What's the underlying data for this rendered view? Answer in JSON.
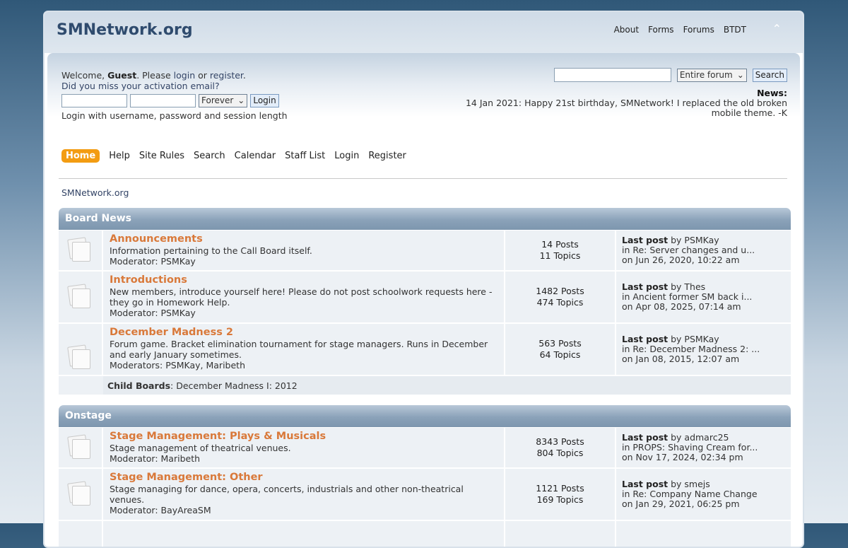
{
  "site": {
    "title": "SMNetwork.org"
  },
  "top_nav": [
    "About",
    "Forms",
    "Forums",
    "BTDT"
  ],
  "user": {
    "welcome_prefix": "Welcome, ",
    "guest": "Guest",
    "please": ". Please ",
    "login": "login",
    "or": " or ",
    "register": "register",
    "period": ".",
    "activation": "Did you miss your activation email?",
    "session": "Forever",
    "login_button": "Login",
    "note": "Login with username, password and session length"
  },
  "search": {
    "scope": "Entire forum",
    "button": "Search"
  },
  "news": {
    "label": "News:",
    "text": "14 Jan 2021: Happy 21st birthday, SMNetwork! I replaced the old broken mobile theme. -K"
  },
  "menu": [
    "Home",
    "Help",
    "Site Rules",
    "Search",
    "Calendar",
    "Staff List",
    "Login",
    "Register"
  ],
  "breadcrumb": "SMNetwork.org",
  "categories": [
    {
      "name": "Board News",
      "boards": [
        {
          "name": "Announcements",
          "desc": "Information pertaining to the Call Board itself.",
          "mods": "Moderator: PSMKay",
          "posts": "14 Posts",
          "topics": "11 Topics",
          "last_label": "Last post",
          "last_by": " by PSMKay",
          "last_in": "in Re: Server changes and u...",
          "last_on": "on Jun 26, 2020, 10:22 am"
        },
        {
          "name": "Introductions",
          "desc": "New members, introduce yourself here! Please do not post schoolwork requests here - they go in Homework Help.",
          "mods": "Moderator: PSMKay",
          "posts": "1482 Posts",
          "topics": "474 Topics",
          "last_label": "Last post",
          "last_by": " by Thes",
          "last_in": "in Ancient former SM back i...",
          "last_on": "on Apr 08, 2025, 07:14 am"
        },
        {
          "name": "December Madness 2",
          "desc": "Forum game. Bracket elimination tournament for stage managers. Runs in December and early January sometimes.",
          "mods": "Moderators: PSMKay, Maribeth",
          "posts": "563 Posts",
          "topics": "64 Topics",
          "last_label": "Last post",
          "last_by": " by PSMKay",
          "last_in": "in Re: December Madness 2: ...",
          "last_on": "on Jan 08, 2015, 12:07 am"
        }
      ],
      "child_label": "Child Boards",
      "child_boards": ": December Madness I: 2012"
    },
    {
      "name": "Onstage",
      "boards": [
        {
          "name": "Stage Management: Plays & Musicals",
          "desc": "Stage management of theatrical venues.",
          "mods": "Moderator: Maribeth",
          "posts": "8343 Posts",
          "topics": "804 Topics",
          "last_label": "Last post",
          "last_by": " by admarc25",
          "last_in": "in PROPS: Shaving Cream for...",
          "last_on": "on Nov 17, 2024, 02:34 pm"
        },
        {
          "name": "Stage Management: Other",
          "desc": "Stage managing for dance, opera, concerts, industrials and other non-theatrical venues.",
          "mods": "Moderator: BayAreaSM",
          "posts": "1121 Posts",
          "topics": "169 Topics",
          "last_label": "Last post",
          "last_by": " by smejs",
          "last_in": "in Re: Company Name Change",
          "last_on": "on Jan 29, 2021, 06:25 pm"
        }
      ]
    }
  ]
}
